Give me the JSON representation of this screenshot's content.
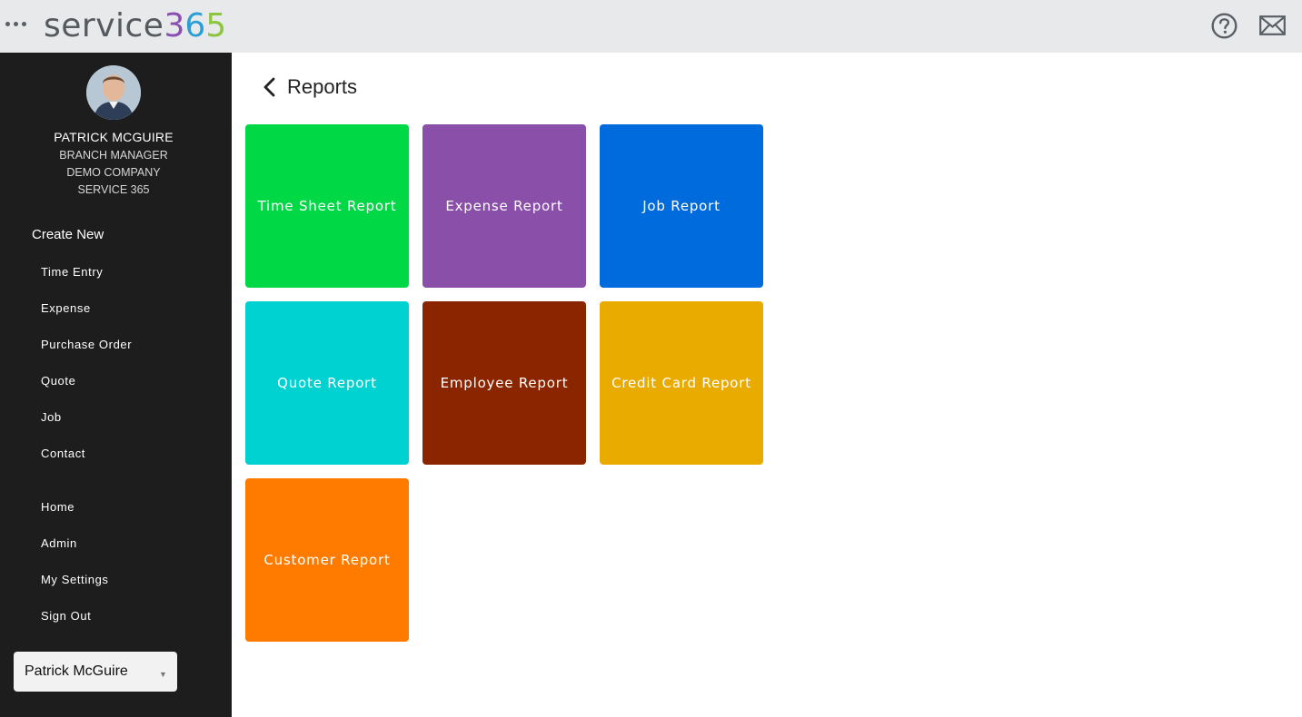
{
  "header": {
    "logo_word": "service",
    "logo_digit_3": "3",
    "logo_digit_6": "6",
    "logo_digit_5": "5",
    "icons": [
      "menu-dots-icon",
      "help-icon",
      "mail-icon"
    ]
  },
  "profile": {
    "name": "PATRICK MCGUIRE",
    "role": "BRANCH MANAGER",
    "company": "DEMO COMPANY",
    "org": "SERVICE 365"
  },
  "sidebar": {
    "create_title": "Create New",
    "create_items": [
      {
        "label": "Time Entry"
      },
      {
        "label": "Expense"
      },
      {
        "label": "Purchase Order"
      },
      {
        "label": "Quote"
      },
      {
        "label": "Job"
      },
      {
        "label": "Contact"
      }
    ],
    "nav_items": [
      {
        "label": "Home"
      },
      {
        "label": "Admin"
      },
      {
        "label": "My Settings"
      },
      {
        "label": "Sign Out"
      }
    ],
    "user_select": {
      "value": "Patrick McGuire"
    }
  },
  "main": {
    "title": "Reports",
    "tiles": [
      {
        "label": "Time Sheet Report",
        "color": "#00d846"
      },
      {
        "label": "Expense Report",
        "color": "#8a4fa8"
      },
      {
        "label": "Job Report",
        "color": "#006bdd"
      },
      {
        "label": "Quote Report",
        "color": "#00d2d2"
      },
      {
        "label": "Employee Report",
        "color": "#8b2500"
      },
      {
        "label": "Credit Card Report",
        "color": "#eaab00"
      },
      {
        "label": "Customer Report",
        "color": "#ff7b00"
      }
    ]
  },
  "colors": {
    "topbar_bg": "#e8e9eb",
    "sidebar_bg": "#1d1d1d",
    "logo_text": "#56595e"
  }
}
